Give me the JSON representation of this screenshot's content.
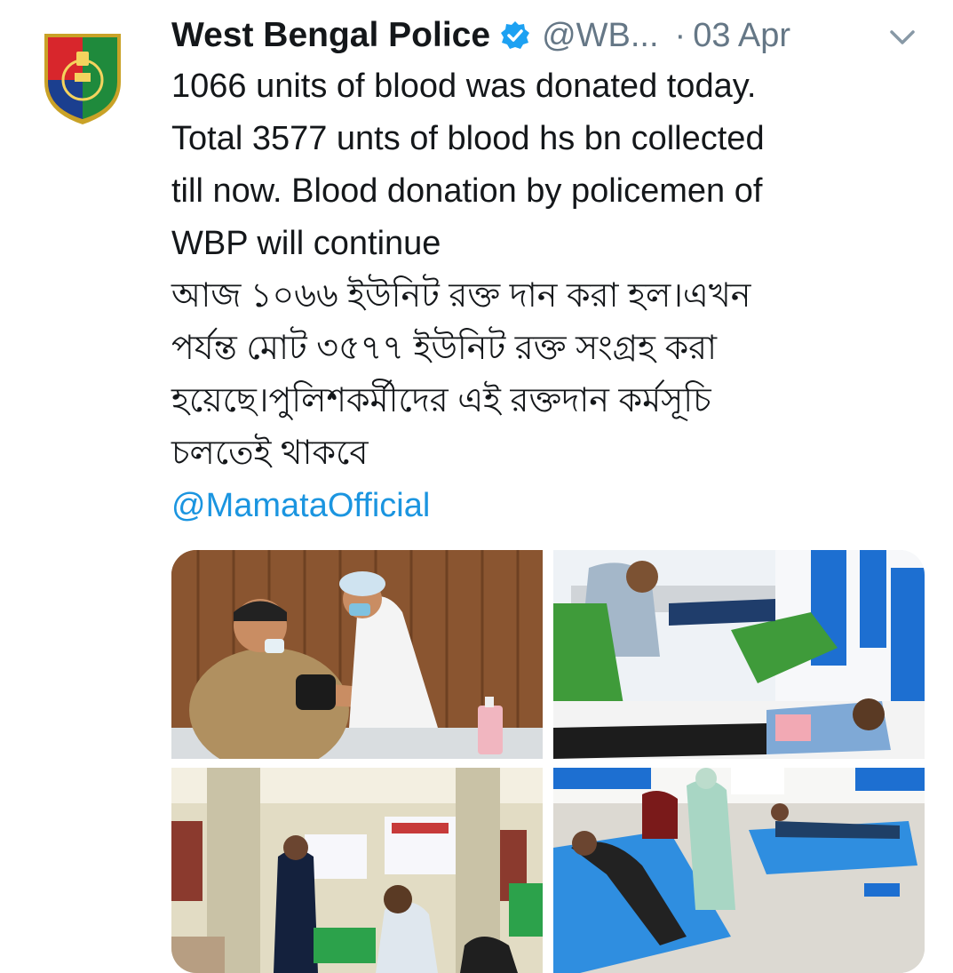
{
  "tweet": {
    "author_name": "West Bengal Police",
    "author_handle": "@WB...",
    "separator": "·",
    "date": "03 Apr",
    "avatar_icon": "west-bengal-police-badge",
    "verified_icon": "verified-badge-icon",
    "menu_icon": "chevron-down-icon",
    "text_lines": [
      "1066 units of blood was donated today.",
      "Total 3577 unts of blood hs bn collected",
      "till now. Blood donation by policemen of",
      "WBP will continue",
      "আজ ১০৬৬ ইউনিট রক্ত দান করা হল।এখন",
      "পর্যন্ত মোট ৩৫৭৭ ইউনিট রক্ত সংগ্রহ করা",
      "হয়েছে।পুলিশকর্মীদের এই রক্তদান কর্মসূচি",
      "চলতেই থাকবে"
    ],
    "mention": "@MamataOfficial",
    "media": [
      {
        "name": "photo-policeman-blood-pressure"
      },
      {
        "name": "photo-donors-on-beds"
      },
      {
        "name": "photo-donation-camp-hall"
      },
      {
        "name": "photo-donors-on-blue-beds"
      }
    ]
  },
  "colors": {
    "text": "#14171a",
    "secondary": "#657786",
    "link": "#1b95e0",
    "verified": "#1da1f2"
  }
}
